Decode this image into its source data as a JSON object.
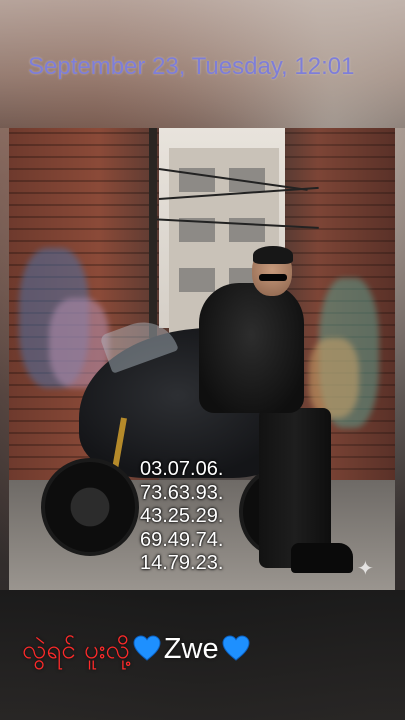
{
  "header": {
    "datetime": "September 23, Tuesday, 12:01"
  },
  "photo": {
    "numbers": [
      "03.07.06.",
      "73.63.93.",
      "43.25.29.",
      "69.49.74.",
      "14.79.23."
    ]
  },
  "caption": {
    "text_myanmar": "လွဲရင် ပူးလို့",
    "name": "Zwe",
    "heart_icon": "blue-heart-icon",
    "heart_color": "#1e90ff"
  },
  "colors": {
    "datetime": "#7e7ed8",
    "caption_text": "#ff2a2a"
  }
}
